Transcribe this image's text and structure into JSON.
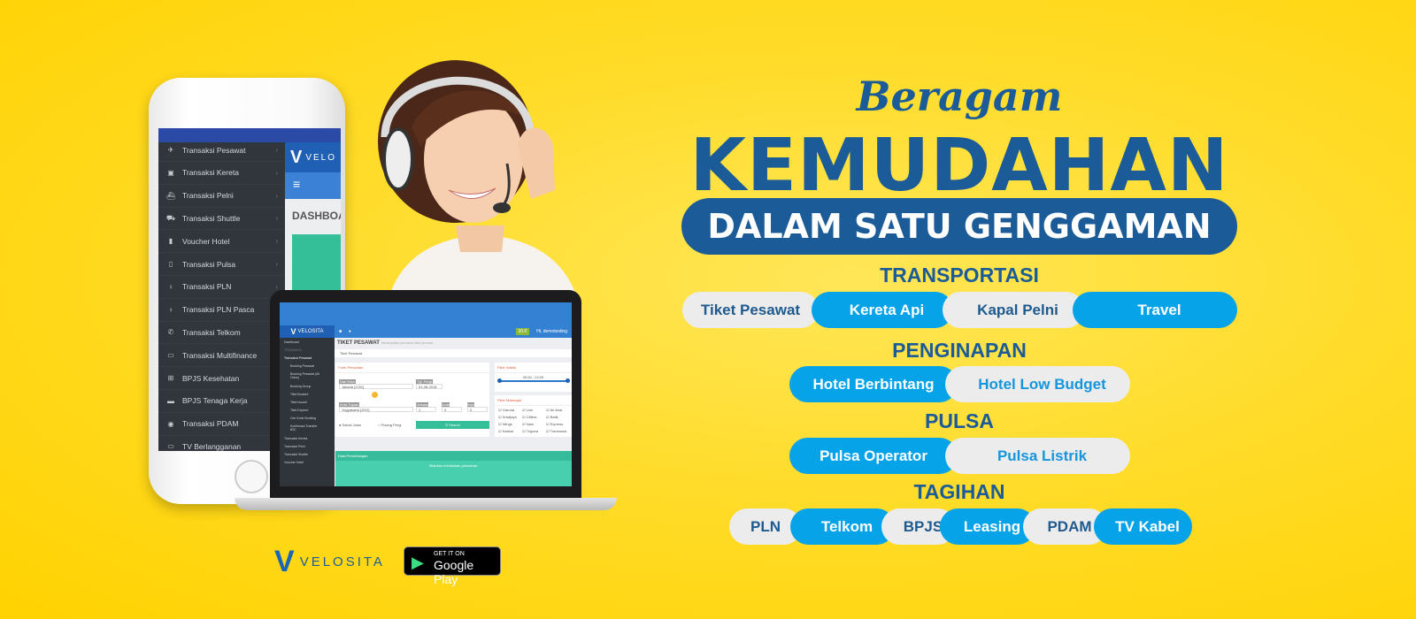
{
  "phone": {
    "menu": [
      {
        "icon": "plane-icon",
        "glyph": "✈",
        "label": "Transaksi Pesawat"
      },
      {
        "icon": "train-icon",
        "glyph": "▣",
        "label": "Transaksi Kereta"
      },
      {
        "icon": "ship-icon",
        "glyph": "⛴",
        "label": "Transaksi Pelni"
      },
      {
        "icon": "car-icon",
        "glyph": "⛟",
        "label": "Transaksi Shuttle"
      },
      {
        "icon": "building-icon",
        "glyph": "▮",
        "label": "Voucher Hotel"
      },
      {
        "icon": "mobile-icon",
        "glyph": "▯",
        "label": "Transaksi Pulsa"
      },
      {
        "icon": "bulb-icon",
        "glyph": "♀",
        "label": "Transaksi PLN"
      },
      {
        "icon": "bulb-icon",
        "glyph": "♀",
        "label": "Transaksi PLN Pasca"
      },
      {
        "icon": "phone-icon",
        "glyph": "✆",
        "label": "Transaksi Telkom"
      },
      {
        "icon": "card-icon",
        "glyph": "▭",
        "label": "Transaksi Multifinance"
      },
      {
        "icon": "medkit-icon",
        "glyph": "⊞",
        "label": "BPJS Kesehatan"
      },
      {
        "icon": "briefcase-icon",
        "glyph": "▬",
        "label": "BPJS Tenaga Kerja"
      },
      {
        "icon": "water-icon",
        "glyph": "◉",
        "label": "Transaksi PDAM"
      },
      {
        "icon": "tv-icon",
        "glyph": "▭",
        "label": "TV Berlangganan"
      }
    ],
    "chevron": "›",
    "brand": "VELO",
    "dashboard": "DASHBOA"
  },
  "laptop": {
    "brand": "VELOSITA",
    "badge": "20.0",
    "user": "Hi, demotesting",
    "sidebar": [
      "Dashboard",
      "TRANSAKSI",
      "Transaksi Pesawat",
      "Booking Pesawat",
      "Booking Pesawat (All Class)",
      "Booking Group",
      "Tiket Booked",
      "Tiket Issued",
      "Tiket Expired",
      "Cek Kode Booking",
      "Konfirmasi Transfer B2C",
      "Transaksi Kereta",
      "Transaksi Pelni",
      "Transaksi Shuttle",
      "Voucher Hotel"
    ],
    "page_title": "TIKET PESAWAT",
    "page_subtitle": "Menampilkan pencarian tiket pesawat",
    "breadcrumb": "Tiket Pesawat",
    "form_title": "Form Pencarian",
    "from_label": "Dari Kota",
    "from_value": "Jakarta [CGK]",
    "date_label": "Tgl. Pergi",
    "date_value": "01-08-2018",
    "to_label": "Kota Tujuan",
    "to_value": "Yogyakarta [JOG]",
    "adult_label": "Dewasa",
    "child_label": "Anak",
    "infant_label": "Bayi",
    "adult": "1",
    "child": "0",
    "infant": "0",
    "oneway": "Sekali Jalan",
    "roundtrip": "Pulang Pergi",
    "search": "Search",
    "time_filter": "Filter Waktu",
    "time_range": "00:00 - 24:00",
    "airline_filter": "Filter Maskapai",
    "airlines": [
      "Garuda",
      "Lion",
      "Air Asia",
      "Sriwijaya",
      "Citilink",
      "Batik",
      "Wings",
      "Nam",
      "Express",
      "Kalstar",
      "Trigana",
      "Transnusa"
    ],
    "results_title": "Data Penerbangan",
    "results_msg": "Silahkan melakukan pencarian."
  },
  "headline": {
    "script": "Beragam",
    "main": "KEMUDAHAN",
    "banner": "DALAM SATU GENGGAMAN"
  },
  "sections": [
    {
      "title": "TRANSPORTASI",
      "items": [
        {
          "label": "Tiket Pesawat",
          "style": "gray"
        },
        {
          "label": "Kereta Api",
          "style": "blue"
        },
        {
          "label": "Kapal Pelni",
          "style": "gray"
        },
        {
          "label": "Travel",
          "style": "blue"
        }
      ]
    },
    {
      "title": "PENGINAPAN",
      "items": [
        {
          "label": "Hotel Berbintang",
          "style": "blue"
        },
        {
          "label": "Hotel Low Budget",
          "style": "gray-light"
        }
      ]
    },
    {
      "title": "PULSA",
      "items": [
        {
          "label": "Pulsa Operator",
          "style": "blue"
        },
        {
          "label": "Pulsa Listrik",
          "style": "gray-light"
        }
      ]
    },
    {
      "title": "TAGIHAN",
      "items": [
        {
          "label": "PLN",
          "style": "gray"
        },
        {
          "label": "Telkom",
          "style": "blue"
        },
        {
          "label": "BPJS",
          "style": "gray"
        },
        {
          "label": "Leasing",
          "style": "blue"
        },
        {
          "label": "PDAM",
          "style": "gray"
        },
        {
          "label": "TV Kabel",
          "style": "blue"
        }
      ]
    }
  ],
  "footer": {
    "brand": "VELOSITA",
    "store_small": "GET IT ON",
    "store_big": "Google Play"
  },
  "colors": {
    "background": "#ffd500",
    "navy": "#1b5c98",
    "blue": "#07a3e8",
    "gray": "#ececec",
    "sidebar": "#30363c"
  }
}
